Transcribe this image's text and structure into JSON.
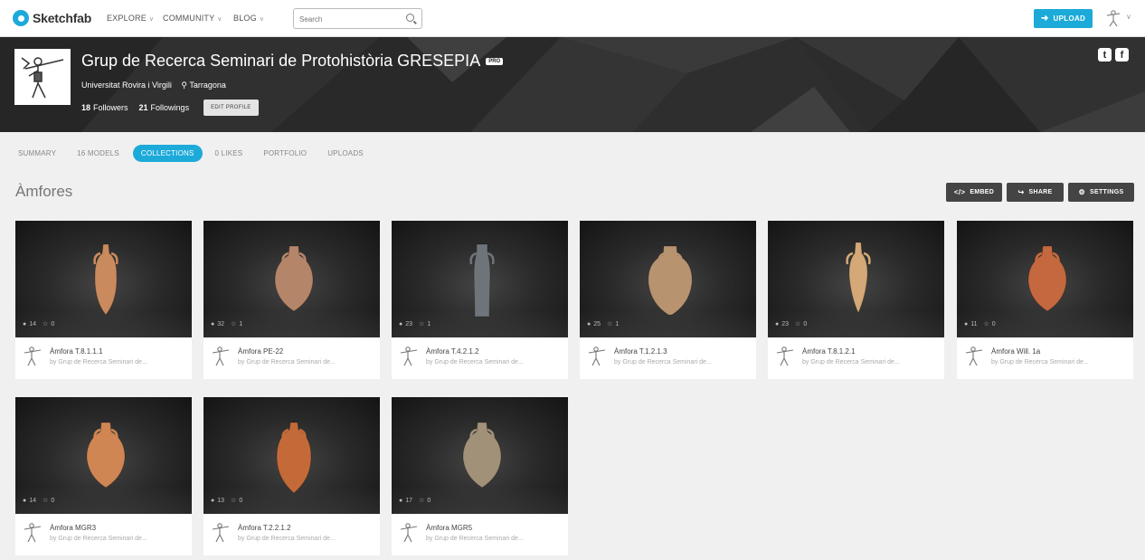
{
  "brand": {
    "name": "Sketchfab"
  },
  "nav": {
    "items": [
      {
        "label": "EXPLORE"
      },
      {
        "label": "COMMUNITY"
      },
      {
        "label": "BLOG"
      }
    ],
    "search_placeholder": "Search",
    "upload_label": "UPLOAD"
  },
  "profile": {
    "name": "Grup de Recerca Seminari de Protohistòria GRESEPIA",
    "badge": "PRO",
    "affiliation": "Universitat Rovira i Virgili",
    "location": "Tarragona",
    "followers_count": "18",
    "followers_label": "Followers",
    "followings_count": "21",
    "followings_label": "Followings",
    "edit_label": "EDIT PROFILE"
  },
  "tabs": [
    {
      "label": "SUMMARY"
    },
    {
      "label": "16 MODELS"
    },
    {
      "label": "COLLECTIONS"
    },
    {
      "label": "0 LIKES"
    },
    {
      "label": "PORTFOLIO"
    },
    {
      "label": "UPLOADS"
    }
  ],
  "collection": {
    "title": "Àmfores",
    "embed_label": "EMBED",
    "share_label": "SHARE",
    "settings_label": "SETTINGS"
  },
  "models": [
    {
      "title": "Àmfora T.8.1.1.1",
      "author": "by Grup de Recerca Seminari de...",
      "views": "14",
      "likes": "0",
      "color": "#c98a5e",
      "shape": "tall"
    },
    {
      "title": "Àmfora PE-22",
      "author": "by Grup de Recerca Seminari de...",
      "views": "32",
      "likes": "1",
      "color": "#b5856a",
      "shape": "round"
    },
    {
      "title": "Àmfora T.4.2.1.2",
      "author": "by Grup de Recerca Seminari de...",
      "views": "23",
      "likes": "1",
      "color": "#6e7479",
      "shape": "cyl"
    },
    {
      "title": "Àmfora T.1.2.1.3",
      "author": "by Grup de Recerca Seminari de...",
      "views": "25",
      "likes": "1",
      "color": "#b89370",
      "shape": "wide"
    },
    {
      "title": "Àmfora T.8.1.2.1",
      "author": "by Grup de Recerca Seminari de...",
      "views": "23",
      "likes": "0",
      "color": "#d4a877",
      "shape": "slim"
    },
    {
      "title": "Àmfora Will. 1a",
      "author": "by Grup de Recerca Seminari de...",
      "views": "11",
      "likes": "0",
      "color": "#c4683f",
      "shape": "round"
    },
    {
      "title": "Àmfora MGR3",
      "author": "by Grup de Recerca Seminari de...",
      "views": "14",
      "likes": "0",
      "color": "#cf8652",
      "shape": "round"
    },
    {
      "title": "Àmfora T.2.2.1.2",
      "author": "by Grup de Recerca Seminari de...",
      "views": "13",
      "likes": "0",
      "color": "#c46a38",
      "shape": "tall2"
    },
    {
      "title": "Àmfora MGR5",
      "author": "by Grup de Recerca Seminari de...",
      "views": "17",
      "likes": "0",
      "color": "#a09178",
      "shape": "round"
    }
  ],
  "colors": {
    "accent": "#1caad9",
    "banner": "#2b2b2b",
    "action_buttons": "#444444"
  }
}
